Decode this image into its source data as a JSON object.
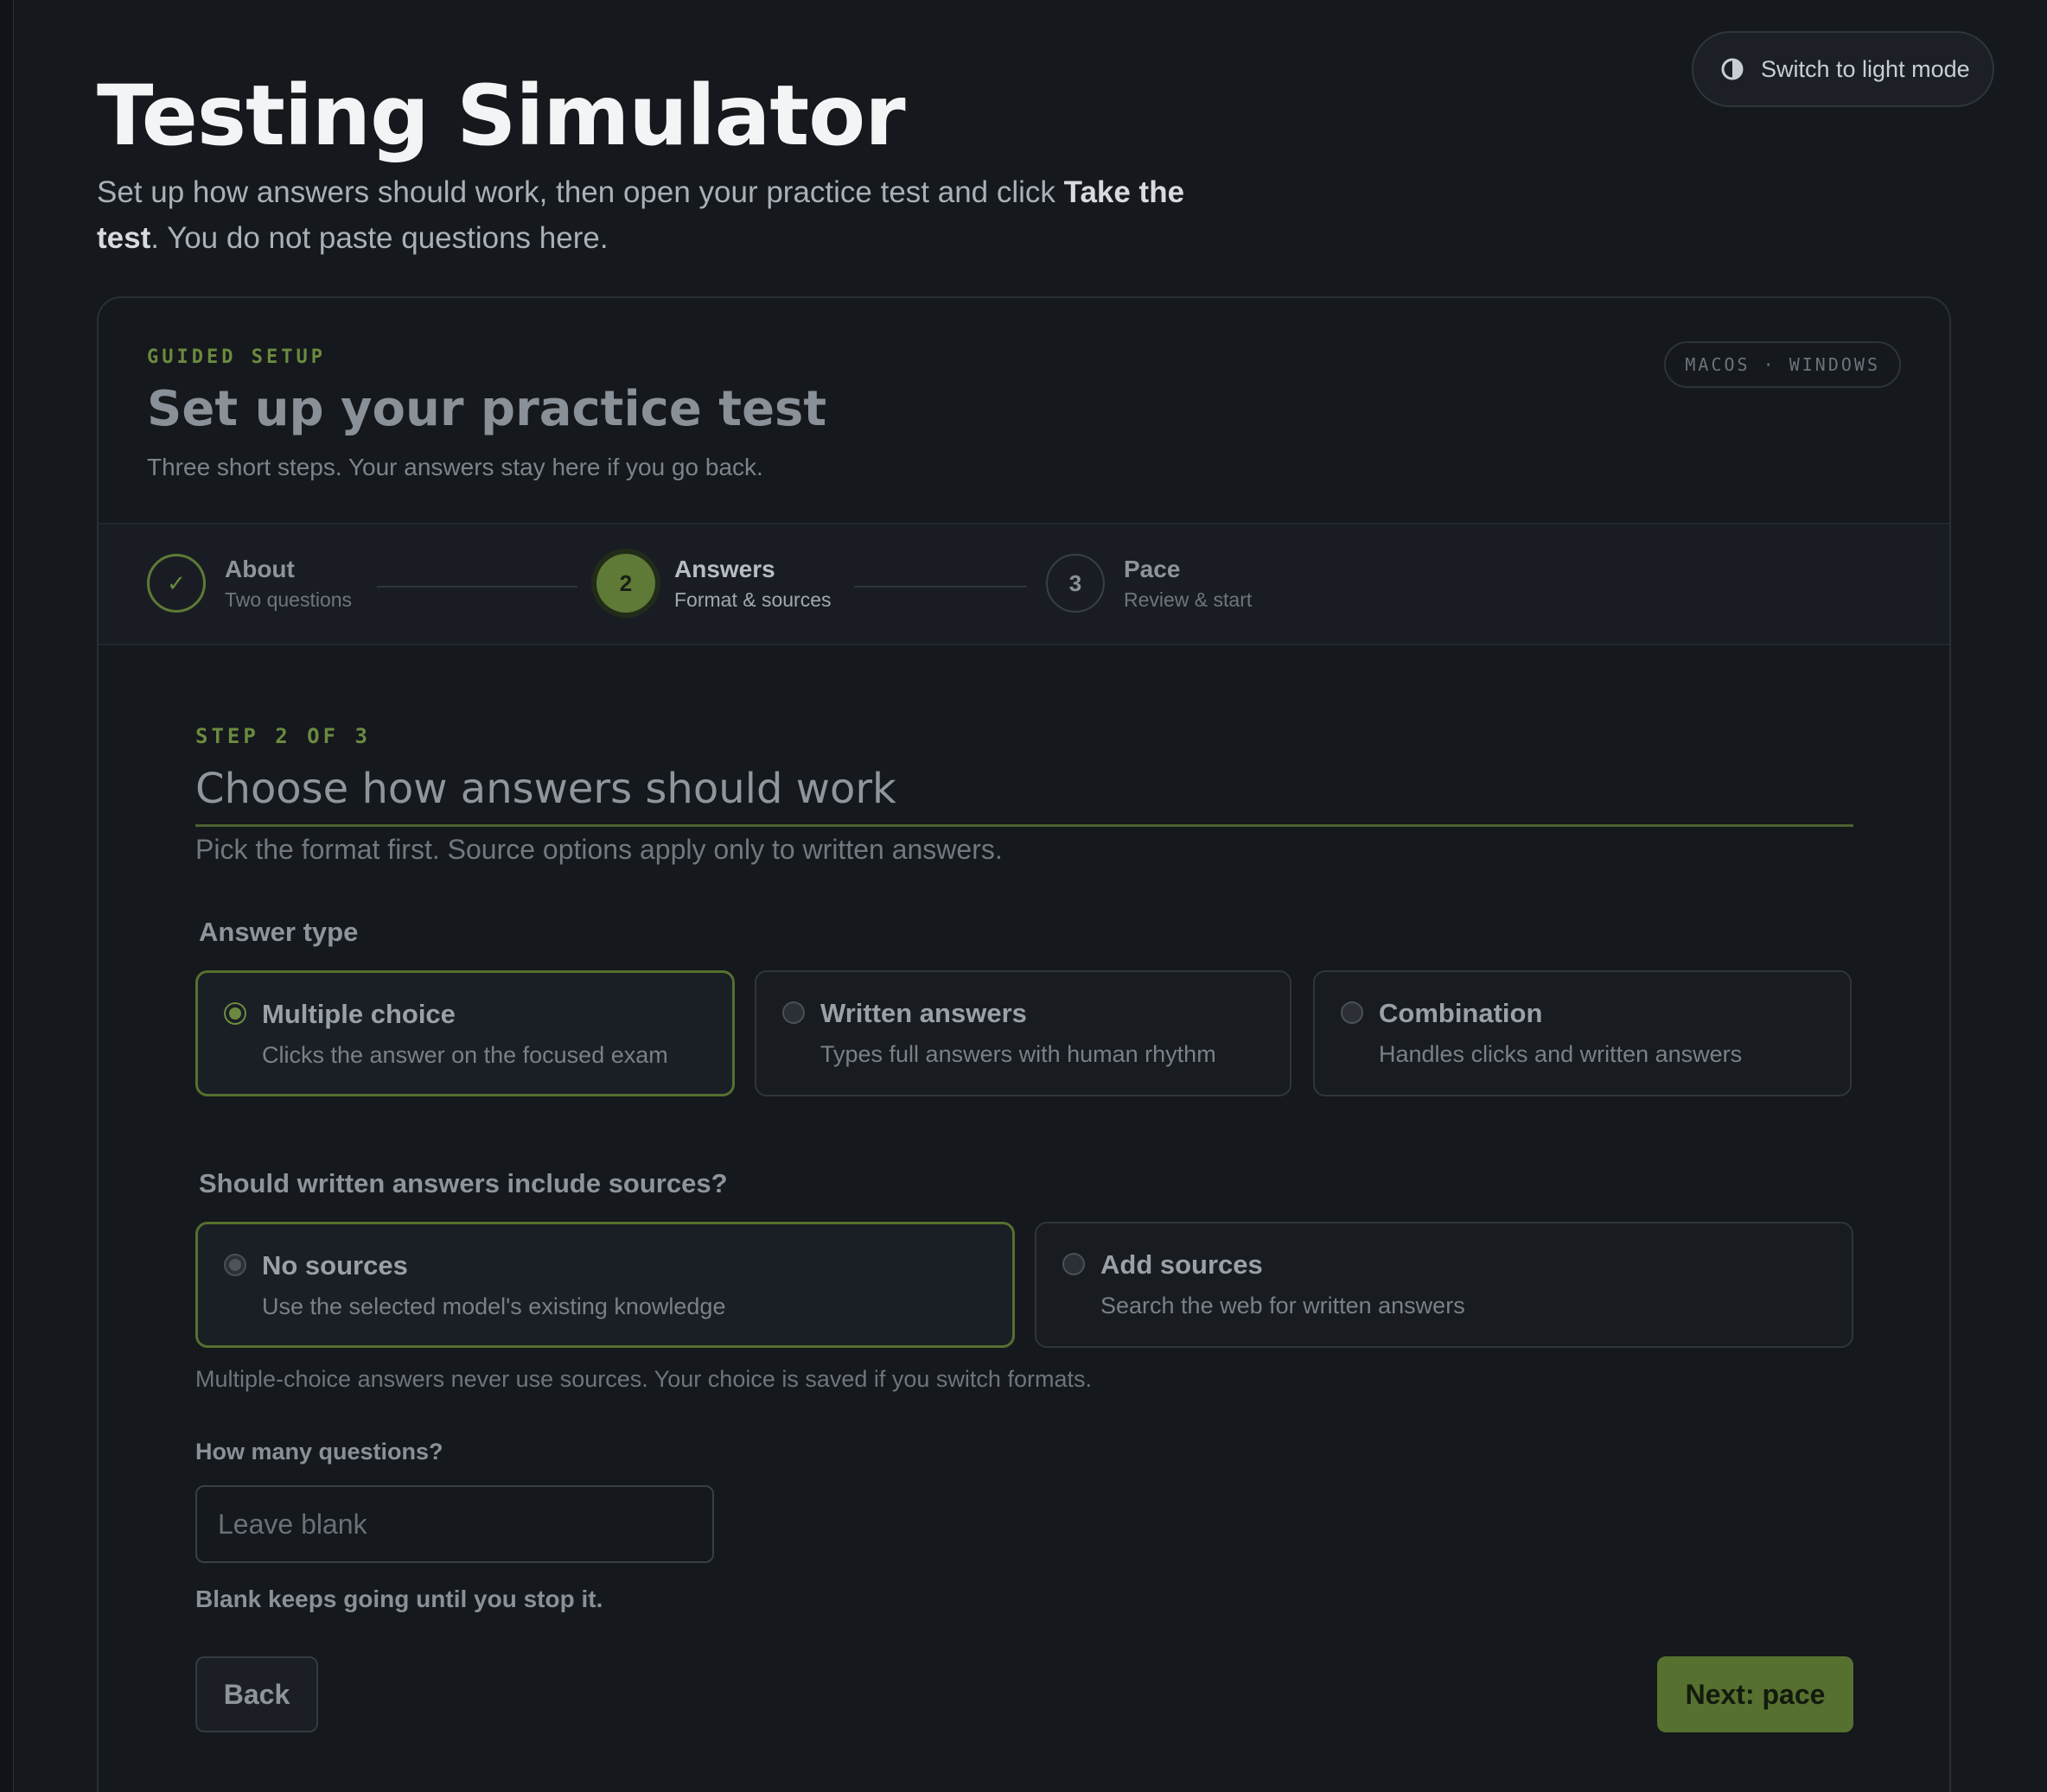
{
  "theme_toggle": {
    "label": "Switch to light mode",
    "icon": "contrast-icon"
  },
  "header": {
    "title": "Testing Simulator",
    "intro_prefix": "Set up how answers should work, then open your practice test and click ",
    "intro_bold": "Take the test",
    "intro_suffix": ". You do not paste questions here."
  },
  "card": {
    "eyebrow": "GUIDED SETUP",
    "title": "Set up your practice test",
    "subtitle": "Three short steps. Your answers stay here if you go back.",
    "os_badge": "MACOS · WINDOWS"
  },
  "stepper": {
    "steps": [
      {
        "marker": "✓",
        "name": "About",
        "desc": "Two questions",
        "state": "done"
      },
      {
        "marker": "2",
        "name": "Answers",
        "desc": "Format & sources",
        "state": "active"
      },
      {
        "marker": "3",
        "name": "Pace",
        "desc": "Review & start",
        "state": "todo"
      }
    ]
  },
  "step": {
    "label": "STEP 2 OF 3",
    "title": "Choose how answers should work",
    "subtitle": "Pick the format first. Source options apply only to written answers."
  },
  "answer_type": {
    "label": "Answer type",
    "options": [
      {
        "title": "Multiple choice",
        "desc": "Clicks the answer on the focused exam",
        "selected": true
      },
      {
        "title": "Written answers",
        "desc": "Types full answers with human rhythm",
        "selected": false
      },
      {
        "title": "Combination",
        "desc": "Handles clicks and written answers",
        "selected": false
      }
    ]
  },
  "sources": {
    "label": "Should written answers include sources?",
    "options": [
      {
        "title": "No sources",
        "desc": "Use the selected model's existing knowledge",
        "selected": true
      },
      {
        "title": "Add sources",
        "desc": "Search the web for written answers",
        "selected": false
      }
    ],
    "note": "Multiple-choice answers never use sources. Your choice is saved if you switch formats."
  },
  "questions": {
    "label": "How many questions?",
    "placeholder": "Leave blank",
    "value": "",
    "hint": "Blank keeps going until you stop it."
  },
  "nav": {
    "back": "Back",
    "next": "Next: pace"
  },
  "colors": {
    "accent": "#5e7a36",
    "background": "#15181c",
    "card_border": "#2a2f36"
  }
}
